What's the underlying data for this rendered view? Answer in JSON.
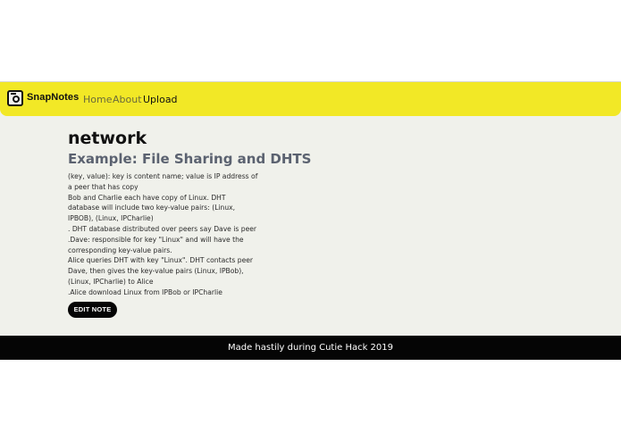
{
  "navbar": {
    "brand": "SnapNotes",
    "logo_icon": "camera-icon",
    "accent_color": "#f2e826",
    "links": [
      {
        "label": "Home"
      },
      {
        "label": "About"
      },
      {
        "label": "Upload"
      }
    ]
  },
  "note": {
    "title": "network",
    "subtitle": "Example: File Sharing and DHTS",
    "lines": [
      "(key, value): key is content name; value is IP address of",
      "a peer that has copy",
      "Bob and Charlie each have copy of Linux. DHT",
      "database will include two key-value pairs: (Linux,",
      "IPBOB), (Linux, IPCharlie)",
      ". DHT database distributed over peers say Dave is peer",
      ".Dave: responsible for key \"Linux\" and will have the",
      "corresponding key-value pairs.",
      "Alice queries DHT with key \"Linux\". DHT contacts peer",
      "Dave, then gives the key-value pairs (Linux, IPBob),",
      "(Linux, IPCharlie) to Alice",
      ".Alice download Linux from IPBob or IPCharlie"
    ],
    "edit_label": "EDIT NOTE"
  },
  "footer": {
    "text": "Made hastily during Cutie Hack 2019"
  }
}
